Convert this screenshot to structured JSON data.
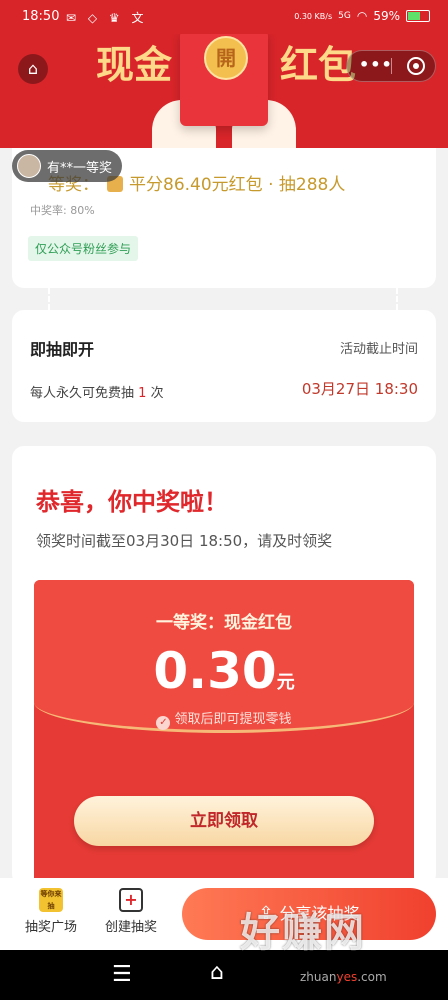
{
  "statusbar": {
    "time": "18:50",
    "network": "0.30 KB/s",
    "signal": "5G",
    "battery": "59%"
  },
  "banner": {
    "title_left": "现金",
    "title_right": "红包",
    "coin_char": "開"
  },
  "prize_card": {
    "winner_text": "有**一等奖",
    "prize_text": "平分86.40元红包 · 抽288人",
    "prize_prefix": "等奖：",
    "win_rate": "中奖率: 80%",
    "badge": "仅公众号粉丝参与"
  },
  "draw_card": {
    "title": "即抽即开",
    "deadline_label": "活动截止时间",
    "rule_prefix": "每人永久可免费抽",
    "rule_count": "1",
    "rule_suffix": "次",
    "deadline": "03月27日 18:30"
  },
  "win_card": {
    "congrats": "恭喜，你中奖啦！",
    "notice": "领奖时间截至03月30日 18:50，请及时领奖",
    "prize_title": "一等奖：现金红包",
    "amount": "0.30",
    "unit": "元",
    "tip": "领取后即可提现零钱",
    "claim_button": "立即领取"
  },
  "tabbar": {
    "tab1_label": "抽奖广场",
    "tab1_icon_text": "等你来抽",
    "tab2_label": "创建抽奖",
    "share_button": "分享该抽奖"
  },
  "watermark": {
    "text": "好赚网",
    "url_a": "zhuan",
    "url_b": "yes",
    "url_c": ".com"
  }
}
